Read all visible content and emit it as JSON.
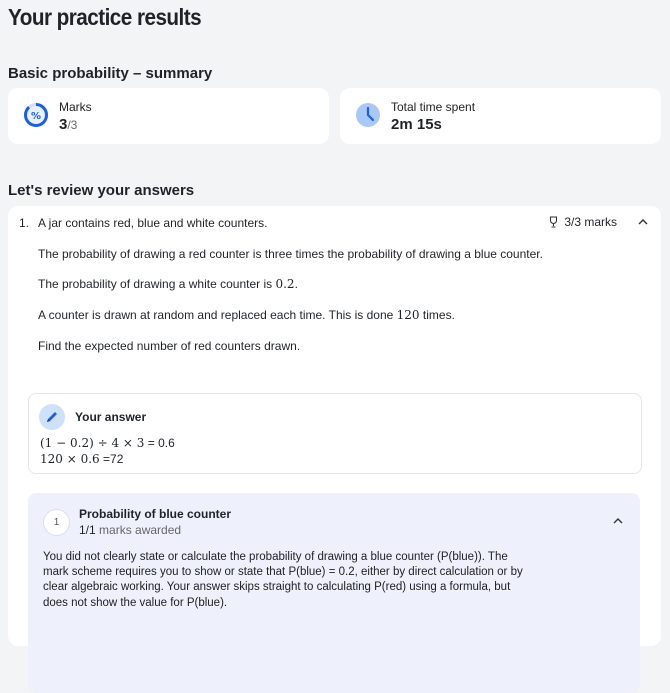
{
  "page": {
    "title": "Your practice results",
    "summary_title": "Basic probability – summary",
    "review_title": "Let's review your answers"
  },
  "stats": {
    "marks": {
      "label": "Marks",
      "value": "3",
      "total": "/3",
      "icon": "percent-progress-icon",
      "progress": 1.0
    },
    "time": {
      "label": "Total time spent",
      "value": "2m 15s",
      "icon": "clock-icon"
    }
  },
  "question": {
    "number": "1.",
    "first_line": "A jar contains red, blue and white counters.",
    "line2": "The probability of drawing a red counter is three times the probability of drawing a blue counter.",
    "line3_pre": "The probability of drawing a white counter is ",
    "line3_math": "0.2",
    "line3_post": ".",
    "line4_pre": "A counter is drawn at random and replaced each time. This is done ",
    "line4_math": "120",
    "line4_post": " times.",
    "line5": "Find the expected number of red counters drawn.",
    "marks_label": "3/3 marks",
    "marks_icon": "trophy-icon"
  },
  "answer": {
    "title": "Your answer",
    "line1_math": "(1 − 0.2) ÷ 4 × 3",
    "line1_rest": " = 0.6",
    "line2_math": "120 × 0.6",
    "line2_rest": " =72"
  },
  "mark_point": {
    "number": "1",
    "title": "Probability of blue counter",
    "awarded_value": "1/1",
    "awarded_suffix": " marks awarded",
    "explanation": "You did not clearly state or calculate the probability of drawing a blue counter (P(blue)). The mark scheme requires you to show or state that P(blue) = 0.2, either by direct calculation or by clear algebraic working. Your answer skips straight to calculating P(red) using a formula, but does not show the value for P(blue)."
  },
  "colors": {
    "background": "#f3f4f6",
    "card": "#ffffff",
    "accent_blue": "#1e5fd6",
    "light_blue": "#cfe0fb",
    "mark_panel": "#eef1fb"
  }
}
